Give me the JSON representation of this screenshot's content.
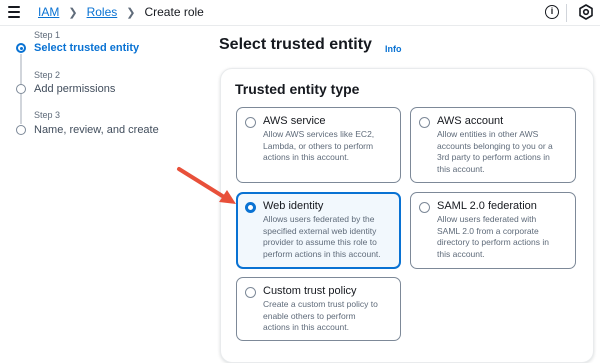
{
  "breadcrumb": {
    "items": [
      {
        "label": "IAM"
      },
      {
        "label": "Roles"
      },
      {
        "label": "Create role"
      }
    ]
  },
  "steps": [
    {
      "number": "Step 1",
      "title": "Select trusted entity",
      "active": true
    },
    {
      "number": "Step 2",
      "title": "Add permissions",
      "active": false
    },
    {
      "number": "Step 3",
      "title": "Name, review, and create",
      "active": false
    }
  ],
  "header": {
    "title": "Select trusted entity",
    "info_label": "Info"
  },
  "panel": {
    "title": "Trusted entity type",
    "options": [
      {
        "title": "AWS service",
        "description": [
          "Allow AWS services like EC2,",
          "Lambda, or others to perform",
          "actions in this account."
        ],
        "selected": false
      },
      {
        "title": "AWS account",
        "description": [
          "Allow entities in other AWS",
          "accounts belonging to you or a",
          "3rd party to perform actions in",
          "this account."
        ],
        "selected": false
      },
      {
        "title": "Web identity",
        "description": [
          "Allows users federated by the",
          "specified external web identity",
          "provider to assume this role to",
          "perform actions in this account."
        ],
        "selected": true
      },
      {
        "title": "SAML 2.0 federation",
        "description": [
          "Allow users federated with",
          "SAML 2.0 from a corporate",
          "directory to perform actions in",
          "this account."
        ],
        "selected": false
      },
      {
        "title": "Custom trust policy",
        "description": [
          "Create a custom trust policy to",
          "enable others to perform",
          "actions in this account."
        ],
        "selected": false
      }
    ]
  },
  "icons": {
    "menu": "hamburger-menu-icon",
    "info": "info-circle-icon",
    "settings": "hexagon-settings-icon",
    "annotation_arrow": "red-arrow-icon"
  },
  "colors": {
    "accent": "#0972d3",
    "selected_background": "#f2f8fd",
    "annotation_arrow": "#e8503a"
  }
}
